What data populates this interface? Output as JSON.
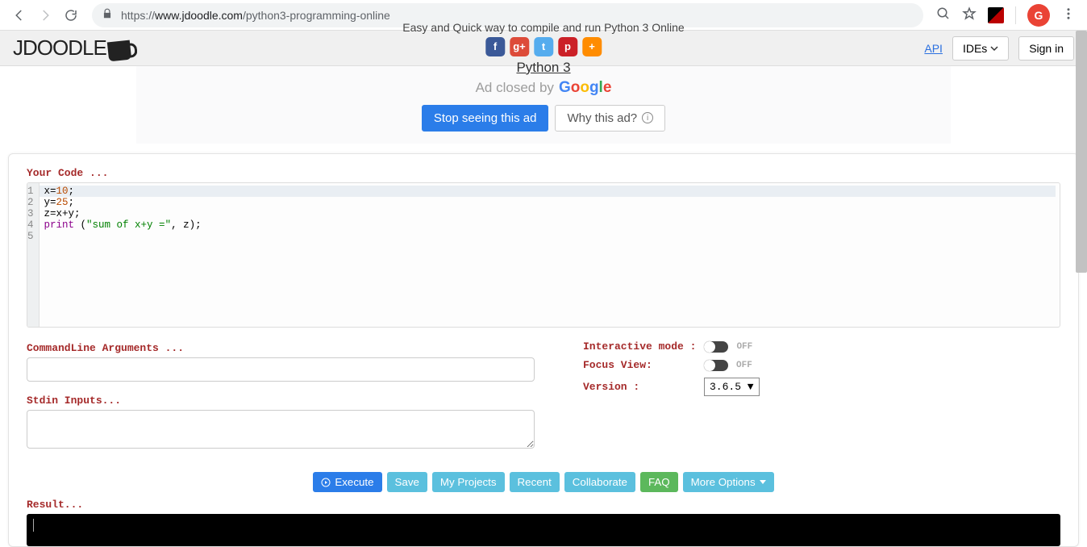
{
  "browser": {
    "url_scheme": "https://",
    "url_host": "www.jdoodle.com",
    "url_path": "/python3-programming-online",
    "avatar_letter": "G"
  },
  "header": {
    "tagline": "Easy and Quick way to compile and run Python 3 Online",
    "language_title": "Python 3",
    "api_link": "API",
    "ides_button": "IDEs",
    "signin_button": "Sign in"
  },
  "ad": {
    "closed_text": "Ad closed by",
    "brand": "Google",
    "stop_button": "Stop seeing this ad",
    "why_button": "Why this ad?"
  },
  "editor": {
    "your_code_label": "Your Code ...",
    "lines": {
      "n1": "1",
      "n2": "2",
      "n3": "3",
      "n4": "4",
      "n5": "5"
    },
    "code": {
      "l1_a": "x=",
      "l1_b": "10",
      "l1_c": ";",
      "l2_a": "y=",
      "l2_b": "25",
      "l2_c": ";",
      "l3": "z=x+y;",
      "l4_a": "print",
      "l4_b": " (",
      "l4_c": "\"sum of x+y =\"",
      "l4_d": ", z);"
    }
  },
  "inputs": {
    "cmdline_label": "CommandLine Arguments ...",
    "stdin_label": "Stdin Inputs..."
  },
  "options": {
    "interactive_label": "Interactive mode :",
    "interactive_state": "OFF",
    "focus_label": "Focus View:",
    "focus_state": "OFF",
    "version_label": "Version :",
    "version_value": "3.6.5 ▼"
  },
  "actions": {
    "execute": "Execute",
    "save": "Save",
    "my_projects": "My Projects",
    "recent": "Recent",
    "collaborate": "Collaborate",
    "faq": "FAQ",
    "more": "More Options"
  },
  "result": {
    "label": "Result..."
  }
}
